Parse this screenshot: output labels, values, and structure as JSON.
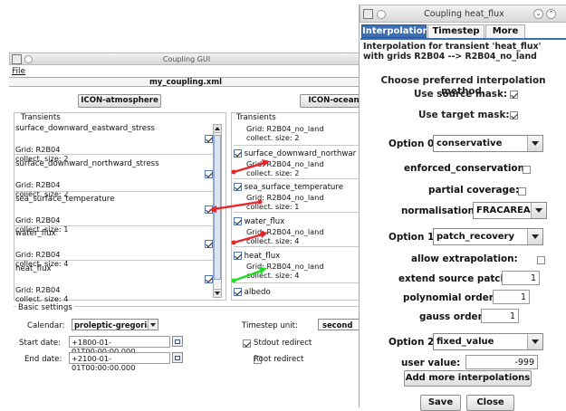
{
  "main_window": {
    "title": "Coupling GUI",
    "menu_file": "File",
    "file_name": "my_coupling.xml",
    "left_component": "ICON-atmosphere",
    "right_component": "ICON-ocean",
    "left_transients_title": "Transients",
    "right_transients_title": "Transients",
    "left_transients": [
      {
        "name": "surface_downward_eastward_stress",
        "grid": "Grid: R2B04",
        "size": "collect. size: 2"
      },
      {
        "name": "surface_downward_northward_stress",
        "grid": "Grid: R2B04",
        "size": "collect. size: 2"
      },
      {
        "name": "sea_surface_temperature",
        "grid": "Grid: R2B04",
        "size": "collect. size: 1"
      },
      {
        "name": "water_flux",
        "grid": "Grid: R2B04",
        "size": "collect. size: 4"
      },
      {
        "name": "heat_flux",
        "grid": "Grid: R2B04",
        "size": "collect. size: 4"
      }
    ],
    "right_top_partial": {
      "grid": "Grid: R2B04_no_land",
      "size": "collect. size: 2"
    },
    "right_transients": [
      {
        "name": "surface_downward_northwar",
        "grid": "Grid: R2B04_no_land",
        "size": "collect. size: 2"
      },
      {
        "name": "sea_surface_temperature",
        "grid": "Grid: R2B04_no_land",
        "size": "collect. size: 1"
      },
      {
        "name": "water_flux",
        "grid": "Grid: R2B04_no_land",
        "size": "collect. size: 4"
      },
      {
        "name": "heat_flux",
        "grid": "Grid: R2B04_no_land",
        "size": "collect. size: 4"
      },
      {
        "name": "albedo"
      }
    ],
    "basic_settings": {
      "title": "Basic settings",
      "calendar_label": "Calendar:",
      "calendar_value": "proleptic-gregorian",
      "start_label": "Start date:",
      "start_value": "+1800-01-01T00:00:00.000",
      "end_label": "End date:",
      "end_value": "+2100-01-01T00:00:00.000",
      "timestep_label": "Timestep unit:",
      "timestep_value": "second",
      "stdout_label": "Stdout redirect",
      "root_label": "Root redirect"
    },
    "link_colors": {
      "red": "#e8262a",
      "green": "#22dd22"
    }
  },
  "dialog": {
    "title": "Coupling heat_flux",
    "tabs": [
      "Interpolation",
      "Timestep",
      "More"
    ],
    "heading_line1": "Interpolation for transient 'heat_flux'",
    "heading_line2": "with grids R2B04 --> R2B04_no_land",
    "choose": "Choose preferred interpolation method.",
    "use_source_mask": "Use source mask:",
    "use_target_mask": "Use target mask:",
    "option0_label": "Option 0",
    "option0_value": "conservative",
    "enforced": "enforced_conservation:",
    "partial": "partial coverage:",
    "normalisation_label": "normalisation:",
    "normalisation_value": "FRACAREA",
    "option1_label": "Option 1",
    "option1_value": "patch_recovery",
    "allow_extrap": "allow extrapolation:",
    "extend_label": "extend source patch:",
    "extend_value": "1",
    "poly_label": "polynomial order:",
    "poly_value": "1",
    "gauss_label": "gauss order:",
    "gauss_value": "1",
    "option2_label": "Option 2",
    "option2_value": "fixed_value",
    "user_value_label": "user value:",
    "user_value": "-999",
    "add_more": "Add more interpolations",
    "save": "Save",
    "close": "Close"
  }
}
